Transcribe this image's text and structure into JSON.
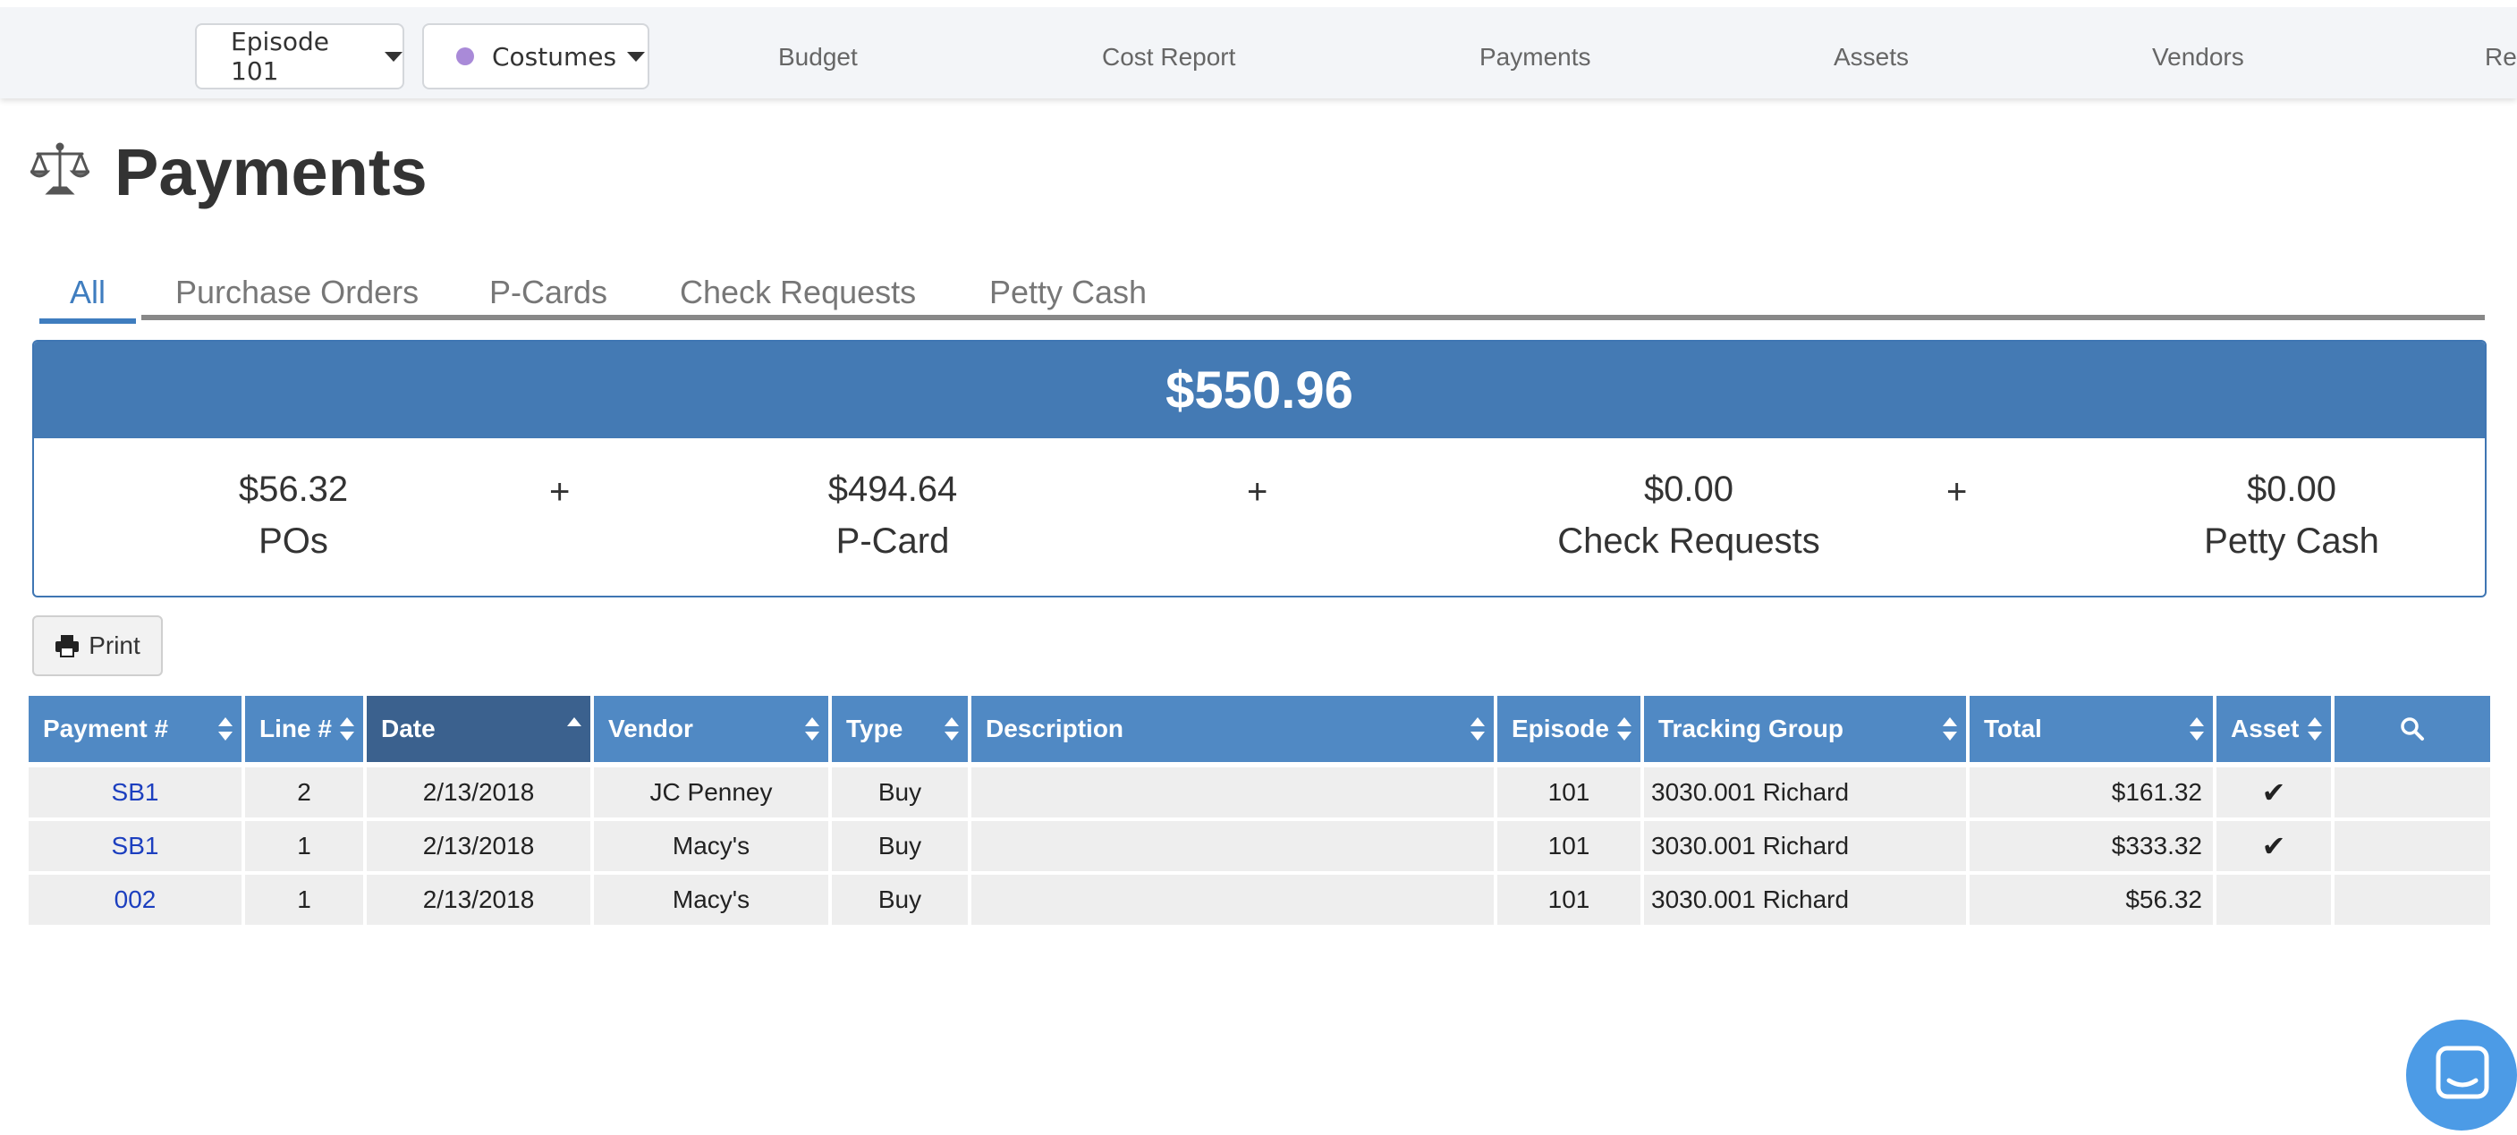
{
  "nav": {
    "episode_selector": "Episode 101",
    "department_selector": "Costumes",
    "department_dot_color": "#a98ad8",
    "links": [
      "Budget",
      "Cost Report",
      "Payments",
      "Assets",
      "Vendors",
      "Re"
    ]
  },
  "page": {
    "title": "Payments",
    "icon": "balance-scale-icon"
  },
  "tabs": [
    "All",
    "Purchase Orders",
    "P-Cards",
    "Check Requests",
    "Petty Cash"
  ],
  "active_tab": "All",
  "summary": {
    "total": "$550.96",
    "plus": "+",
    "items": [
      {
        "amount": "$56.32",
        "label": "POs"
      },
      {
        "amount": "$494.64",
        "label": "P-Card"
      },
      {
        "amount": "$0.00",
        "label": "Check Requests"
      },
      {
        "amount": "$0.00",
        "label": "Petty Cash"
      }
    ]
  },
  "print_label": "Print",
  "table": {
    "headers": [
      "Payment #",
      "Line #",
      "Date",
      "Vendor",
      "Type",
      "Description",
      "Episode",
      "Tracking Group",
      "Total",
      "Asset"
    ],
    "sorted_column": "Date",
    "rows": [
      {
        "payment": "SB1",
        "line": "2",
        "date": "2/13/2018",
        "vendor": "JC Penney",
        "type": "Buy",
        "description": "",
        "episode": "101",
        "tracking": "3030.001 Richard",
        "total": "$161.32",
        "asset": "✔"
      },
      {
        "payment": "SB1",
        "line": "1",
        "date": "2/13/2018",
        "vendor": "Macy's",
        "type": "Buy",
        "description": "",
        "episode": "101",
        "tracking": "3030.001 Richard",
        "total": "$333.32",
        "asset": "✔"
      },
      {
        "payment": "002",
        "line": "1",
        "date": "2/13/2018",
        "vendor": "Macy's",
        "type": "Buy",
        "description": "",
        "episode": "101",
        "tracking": "3030.001 Richard",
        "total": "$56.32",
        "asset": ""
      }
    ]
  },
  "colors": {
    "accent": "#447ab4",
    "header": "#5089c4",
    "header_sorted": "#3b618e",
    "link": "#1c3fbf",
    "chat": "#4c9be6"
  }
}
